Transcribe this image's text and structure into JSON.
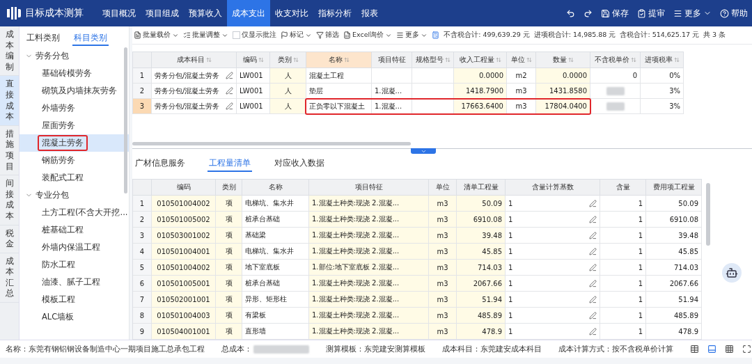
{
  "app": {
    "title": "目标成本测算"
  },
  "nav": [
    {
      "label": "项目概况",
      "selected": false
    },
    {
      "label": "项目组成",
      "selected": false
    },
    {
      "label": "预算收入",
      "selected": false
    },
    {
      "label": "成本支出",
      "selected": true
    },
    {
      "label": "收支对比",
      "selected": false
    },
    {
      "label": "指标分析",
      "selected": false
    },
    {
      "label": "报表",
      "selected": false
    }
  ],
  "actions": [
    {
      "kind": "undo"
    },
    {
      "kind": "redo"
    },
    {
      "kind": "save",
      "label": "保存"
    },
    {
      "kind": "submit",
      "label": "提审"
    },
    {
      "kind": "more",
      "label": "更多"
    },
    {
      "kind": "help",
      "label": "帮助"
    }
  ],
  "side_nav": [
    {
      "label": "成本编制",
      "selected": false
    },
    {
      "label": "直接成本",
      "selected": true
    },
    {
      "label": "措施项目",
      "selected": false
    },
    {
      "label": "间接成本",
      "selected": false
    },
    {
      "label": "税金",
      "selected": false
    },
    {
      "label": "成本汇总",
      "selected": false
    }
  ],
  "category_tabs": [
    {
      "label": "工料类别",
      "selected": false
    },
    {
      "label": "科目类别",
      "selected": true
    }
  ],
  "tree": [
    {
      "label": "劳务分包",
      "expanded": true,
      "children": [
        {
          "label": "基础砖模劳务",
          "selected": false,
          "highlighted": false
        },
        {
          "label": "砌筑及内墙抹灰劳务",
          "selected": false,
          "highlighted": false
        },
        {
          "label": "外墙劳务",
          "selected": false,
          "highlighted": false
        },
        {
          "label": "屋面劳务",
          "selected": false,
          "highlighted": false
        },
        {
          "label": "混凝土劳务",
          "selected": true,
          "highlighted": true
        },
        {
          "label": "钢筋劳务",
          "selected": false,
          "highlighted": false
        },
        {
          "label": "装配式工程",
          "selected": false,
          "highlighted": false
        }
      ]
    },
    {
      "label": "专业分包",
      "expanded": true,
      "children": [
        {
          "label": "土方工程(不含大开挖...",
          "selected": false,
          "highlighted": false
        },
        {
          "label": "桩基础工程",
          "selected": false,
          "highlighted": false
        },
        {
          "label": "外墙内保温工程",
          "selected": false,
          "highlighted": false
        },
        {
          "label": "防水工程",
          "selected": false,
          "highlighted": false
        },
        {
          "label": "油漆、腻子工程",
          "selected": false,
          "highlighted": false
        },
        {
          "label": "模板工程",
          "selected": false,
          "highlighted": false
        },
        {
          "label": "ALC墙板",
          "selected": false,
          "highlighted": false
        }
      ]
    }
  ],
  "toolbar": [
    {
      "kind": "price",
      "label": "批量载价"
    },
    {
      "kind": "adjust",
      "label": "批量调整"
    },
    {
      "kind": "checkbox",
      "label": "仅显示批注",
      "checked": false
    },
    {
      "kind": "flag",
      "label": "标记"
    },
    {
      "kind": "filter",
      "label": "筛选"
    },
    {
      "kind": "excel",
      "label": "Excel询价"
    },
    {
      "kind": "more",
      "label": "更多"
    }
  ],
  "summary": [
    "不含税合计: 499,639.29 元",
    "进项税合计: 14,985.88 元",
    "含税合计: 514,625.17 元"
  ],
  "count": "共 3 条",
  "upper_table": {
    "columns": [
      {
        "label": "成本科目",
        "kind": "editable",
        "sortable": true,
        "active": false
      },
      {
        "label": "编码",
        "kind": "plain",
        "sortable": true,
        "active": false
      },
      {
        "label": "类别",
        "kind": "input",
        "sortable": true,
        "active": false
      },
      {
        "label": "名称",
        "kind": "plain",
        "sortable": true,
        "active": true
      },
      {
        "label": "项目特征",
        "kind": "plain",
        "sortable": false,
        "active": false
      },
      {
        "label": "规格型号",
        "kind": "plain",
        "sortable": true,
        "active": false
      },
      {
        "label": "收入工程量",
        "kind": "input",
        "sortable": true,
        "active": false
      },
      {
        "label": "单位",
        "kind": "plain",
        "sortable": true,
        "active": false
      },
      {
        "label": "数量",
        "kind": "input",
        "sortable": true,
        "active": false
      },
      {
        "label": "不含税单价",
        "kind": "plain",
        "sortable": true,
        "active": false
      },
      {
        "label": "进项税率",
        "kind": "plain",
        "sortable": true,
        "active": false
      }
    ],
    "rows": [
      {
        "number": "1",
        "selected": false,
        "highlighted": false,
        "cells": [
          "劳务分包/混凝土劳务",
          "LW001",
          "人",
          "混凝土工程",
          null,
          null,
          "0.0000",
          "m2",
          "0.0000",
          "0",
          "0%"
        ]
      },
      {
        "number": "2",
        "selected": false,
        "highlighted": false,
        "cells": [
          "劳务分包/混凝土劳务",
          "LW001",
          "人",
          "垫层",
          "1.混凝...",
          null,
          "1418.7900",
          "m3",
          "1431.8580",
          {
            "redacted": true
          },
          "3%"
        ]
      },
      {
        "number": "3",
        "selected": true,
        "highlighted": true,
        "cells": [
          "劳务分包/混凝土劳务",
          "LW001",
          "人",
          "正负零以下混凝土",
          "1.混凝...",
          null,
          "17663.6400",
          "m3",
          "17804.0400",
          {
            "redacted": true
          },
          "3%"
        ]
      }
    ]
  },
  "detail_tabs": [
    {
      "label": "广材信息服务",
      "selected": false
    },
    {
      "label": "工程量清单",
      "selected": true
    },
    {
      "label": "对应收入数据",
      "selected": false
    }
  ],
  "lower_table": {
    "columns": [
      {
        "label": "编码",
        "kind": "input"
      },
      {
        "label": "类别",
        "kind": "input"
      },
      {
        "label": "名称",
        "kind": "plain"
      },
      {
        "label": "项目特征",
        "kind": "input"
      },
      {
        "label": "单位",
        "kind": "input"
      },
      {
        "label": "清单工程量",
        "kind": "input"
      },
      {
        "label": "含量计算基数",
        "kind": "editable"
      },
      {
        "label": "含量",
        "kind": "plain"
      },
      {
        "label": "费用项工程量",
        "kind": "plain"
      }
    ],
    "rows": [
      {
        "number": "1",
        "cells": [
          "010501004002",
          "项",
          "电梯坑、集水井",
          "1.混凝土种类:现浇 2.混凝...",
          "m3",
          "50.09",
          "1",
          "1",
          "50.09"
        ]
      },
      {
        "number": "2",
        "cells": [
          "010501005002",
          "项",
          "桩承台基础",
          "1.混凝土种类:现浇 2.混凝...",
          "m3",
          "6910.08",
          "1",
          "1",
          "6910.08"
        ]
      },
      {
        "number": "3",
        "cells": [
          "010503001002",
          "项",
          "基础梁",
          "1.混凝土种类:现浇 2.混凝...",
          "m3",
          "39.48",
          "1",
          "1",
          "39.48"
        ]
      },
      {
        "number": "4",
        "cells": [
          "010501004001",
          "项",
          "电梯坑、集水井",
          "1.混凝土种类:现浇 2.混凝...",
          "m3",
          "45.85",
          "1",
          "1",
          "45.85"
        ]
      },
      {
        "number": "5",
        "cells": [
          "010501004002",
          "项",
          "地下室底板",
          "1.部位:地下室底板 2.混凝...",
          "m3",
          "714.03",
          "1",
          "1",
          "714.03"
        ]
      },
      {
        "number": "6",
        "cells": [
          "010501005001",
          "项",
          "桩承台基础",
          "1.混凝土种类:现浇 2.混凝...",
          "m3",
          "2067.66",
          "1",
          "1",
          "2067.66"
        ]
      },
      {
        "number": "7",
        "cells": [
          "010502001001",
          "项",
          "异形、矩形柱",
          "1.混凝土种类:现浇 2.混凝...",
          "m3",
          "51.94",
          "1",
          "1",
          "51.94"
        ]
      },
      {
        "number": "8",
        "cells": [
          "010501004003",
          "项",
          "有梁板",
          "1.混凝土种类:现浇 2.混凝...",
          "m3",
          "485.89",
          "1",
          "1",
          "485.89"
        ]
      },
      {
        "number": "9",
        "cells": [
          "010504001001",
          "项",
          "直形墙",
          "1.混凝土种类:现浇 2.混凝...",
          "m3",
          "478.9",
          "1",
          "1",
          "478.9"
        ]
      }
    ]
  },
  "status_bar": [
    {
      "label": "名称：东莞有钢铝钢设备制造中心一期项目施工总承包工程",
      "redacted": false
    },
    {
      "label": "总成本：",
      "redacted": true
    },
    {
      "label": "测算模板：东莞建安测算模板",
      "redacted": false
    },
    {
      "label": "成本科目：东莞建安成本科目",
      "redacted": false
    },
    {
      "label": "成本计算方式：按不含税单价计算",
      "redacted": false
    }
  ],
  "view_buttons": [
    {
      "kind": "grid",
      "selected": false
    },
    {
      "kind": "split",
      "selected": true
    },
    {
      "kind": "cells",
      "selected": false
    },
    {
      "kind": "fullscreen",
      "selected": false
    }
  ]
}
